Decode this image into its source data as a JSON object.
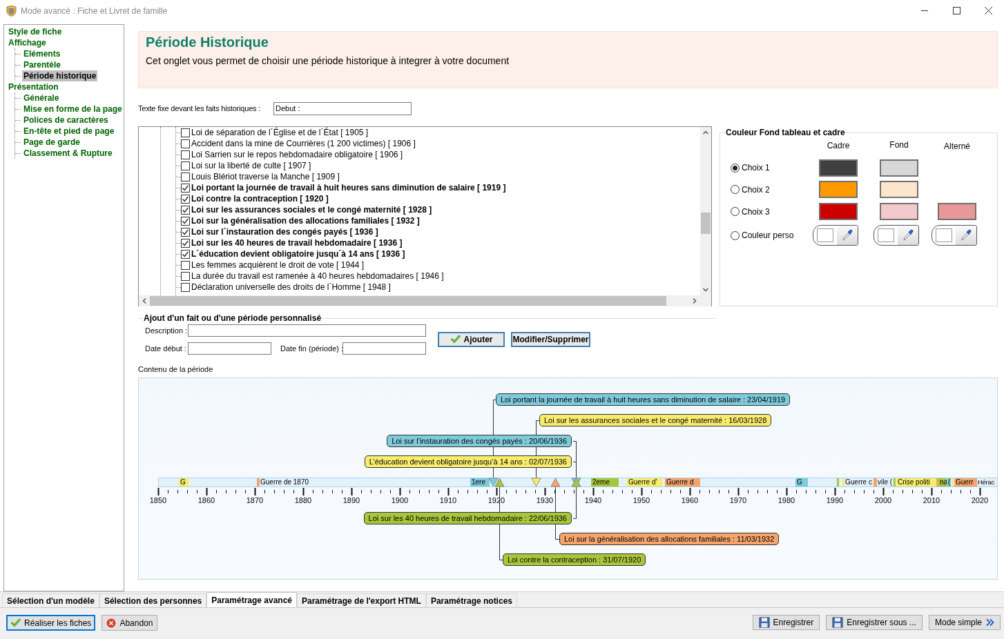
{
  "window": {
    "title": "Mode avancé : Fiche et Livret de famille"
  },
  "sidebar": {
    "items": [
      {
        "label": "Style de fiche",
        "selected": false
      },
      {
        "label": "Affichage",
        "selected": false,
        "children": [
          {
            "label": "Eléments",
            "selected": false
          },
          {
            "label": "Parentèle",
            "selected": false
          },
          {
            "label": "Période historique",
            "selected": true
          }
        ]
      },
      {
        "label": "Présentation",
        "selected": false,
        "children": [
          {
            "label": "Générale",
            "selected": false
          },
          {
            "label": "Mise en forme de la page",
            "selected": false
          },
          {
            "label": "Polices de caractères",
            "selected": false
          },
          {
            "label": "En-tête et pied de page",
            "selected": false
          },
          {
            "label": "Page de garde",
            "selected": false
          },
          {
            "label": "Classement & Rupture",
            "selected": false
          }
        ]
      }
    ]
  },
  "header": {
    "title": "Période Historique",
    "subtitle": "Cet onglet vous permet de choisir une période historique à integrer à votre document"
  },
  "fixed_text": {
    "label": "Texte fixe devant les faits historiques :",
    "value": "Debut :"
  },
  "facts_list": [
    {
      "label": "Loi de séparation de l´Église et de l´État [ 1905 ]",
      "checked": false
    },
    {
      "label": "Accident dans la mine de Courrières (1 200 victimes) [ 1906 ]",
      "checked": false
    },
    {
      "label": "Loi Sarrien sur le repos hebdomadaire obligatoire [ 1906 ]",
      "checked": false
    },
    {
      "label": "Loi sur la liberté de culte [ 1907 ]",
      "checked": false
    },
    {
      "label": "Louis Blériot traverse la Manche [ 1909 ]",
      "checked": false
    },
    {
      "label": "Loi portant la journée de travail à huit heures sans diminution de salaire [ 1919 ]",
      "checked": true
    },
    {
      "label": "Loi contre la contraception [ 1920 ]",
      "checked": true
    },
    {
      "label": "Loi sur les assurances sociales et le congé maternité [ 1928 ]",
      "checked": true
    },
    {
      "label": "Loi sur la généralisation des allocations familiales [ 1932 ]",
      "checked": true
    },
    {
      "label": "Loi sur l´instauration des congés payés [ 1936 ]",
      "checked": true
    },
    {
      "label": "Loi sur les 40 heures de travail hebdomadaire [ 1936 ]",
      "checked": true
    },
    {
      "label": "L´éducation devient obligatoire jusqu´à 14 ans [ 1936 ]",
      "checked": true
    },
    {
      "label": "Les femmes acquièrent le droit de vote [ 1944 ]",
      "checked": false
    },
    {
      "label": "La durée du travail est ramenée à 40 heures hebdomadaires [ 1946 ]",
      "checked": false
    },
    {
      "label": "Déclaration universelle des droits de l´Homme [ 1948 ]",
      "checked": false
    }
  ],
  "color_panel": {
    "title": "Couleur Fond tableau et cadre",
    "columns": [
      "Cadre",
      "Fond",
      "Alterné"
    ],
    "options": [
      {
        "label": "Choix 1",
        "selected": true,
        "kind": "preset",
        "swatches": [
          {
            "color": "#404040"
          },
          {
            "color": "#d7d7d7"
          }
        ]
      },
      {
        "label": "Choix 2",
        "selected": false,
        "kind": "preset",
        "swatches": [
          {
            "color": "#ff9900"
          },
          {
            "color": "#fde5cd"
          }
        ]
      },
      {
        "label": "Choix 3",
        "selected": false,
        "kind": "preset",
        "swatches": [
          {
            "color": "#cc0000"
          },
          {
            "color": "#f3cacb"
          },
          {
            "color": "#e89898"
          }
        ]
      },
      {
        "label": "Couleur perso",
        "selected": false,
        "kind": "custom"
      }
    ]
  },
  "custom_form": {
    "title": "Ajout d'un fait ou d'une période personnalisé",
    "description_label": "Description :",
    "start_label": "Date début :",
    "end_label": "Date fin (période) :",
    "buttons": [
      "Ajouter",
      "Modifier/Supprimer"
    ]
  },
  "timeline": {
    "label": "Contenu de la période",
    "axis_labels": [
      "1850",
      "1860",
      "1870",
      "1880",
      "1890",
      "1900",
      "1910",
      "1920",
      "1930",
      "1940",
      "1950",
      "1960",
      "1970",
      "1980",
      "1990",
      "2000",
      "2010",
      "2020"
    ],
    "periods": [
      {
        "kind": "block",
        "label": "G",
        "color": "#f8ec6c"
      },
      {
        "kind": "tick",
        "label": "Guerre de 1870",
        "color": "#f4a46c"
      },
      {
        "kind": "block",
        "label": "1ere",
        "color": "#7fcadb"
      },
      {
        "kind": "block",
        "label": "2eme",
        "color": "#a8c63c"
      },
      {
        "kind": "block",
        "label": "Guerre d'",
        "color": "#f8ec6c"
      },
      {
        "kind": "block",
        "label": "Guerre d",
        "color": "#f4a46c"
      },
      {
        "kind": "block",
        "label": "G",
        "color": "#7fcadb"
      },
      {
        "kind": "tick",
        "color": "#a8c63c"
      },
      {
        "kind": "tick",
        "label": "Guerre c",
        "color": "#f8ec6c"
      },
      {
        "kind": "tick",
        "label": "vile (",
        "color": "#f4a46c"
      },
      {
        "kind": "tick",
        "color": "#a8c63c"
      },
      {
        "kind": "block",
        "label": "Crise politi",
        "color": "#f8ec6c"
      },
      {
        "kind": "tick",
        "color": "#f4a46c"
      },
      {
        "kind": "block",
        "label": "na",
        "color": "#a8c63c"
      },
      {
        "kind": "block",
        "label": "(",
        "color": "#7fcadb"
      },
      {
        "kind": "tick",
        "color": "#f8ec6c"
      },
      {
        "kind": "block",
        "label": "Guerr",
        "color": "#f4a46c"
      },
      {
        "kind": "text",
        "label": "Hérac"
      }
    ],
    "events": [
      {
        "label": "Loi portant la journée de travail à huit heures sans diminution de salaire : 23/04/1919",
        "color": "#7fcadb",
        "kind": "above"
      },
      {
        "label": "Loi sur les assurances sociales et le congé maternité : 16/03/1928",
        "color": "#f8ec6c",
        "kind": "above"
      },
      {
        "label": "Loi sur l’instauration des congés payés : 20/06/1936",
        "color": "#7fcadb",
        "kind": "above"
      },
      {
        "label": "L’éducation devient obligatoire jusqu’à 14 ans : 02/07/1936",
        "color": "#f8ec6c",
        "kind": "above"
      },
      {
        "label": "Loi sur les 40 heures de travail hebdomadaire : 22/06/1936",
        "color": "#a8c63c",
        "kind": "below"
      },
      {
        "label": "Loi sur la généralisation des allocations familiales : 11/03/1932",
        "color": "#f4a46c",
        "kind": "below"
      },
      {
        "label": "Loi contre la contraception : 31/07/1920",
        "color": "#a8c63c",
        "kind": "below"
      }
    ]
  },
  "tabs": [
    {
      "label": "Sélection d'un modèle",
      "selected": false
    },
    {
      "label": "Sélection des personnes",
      "selected": false
    },
    {
      "label": "Paramétrage avancé",
      "selected": true
    },
    {
      "label": "Paramétrage de l'export HTML",
      "selected": false
    },
    {
      "label": "Paramétrage notices",
      "selected": false
    }
  ],
  "actions": {
    "left": [
      "Réaliser les fiches",
      "Abandon"
    ],
    "right": [
      "Enregistrer",
      "Enregistrer sous ...",
      "Mode simple"
    ]
  }
}
